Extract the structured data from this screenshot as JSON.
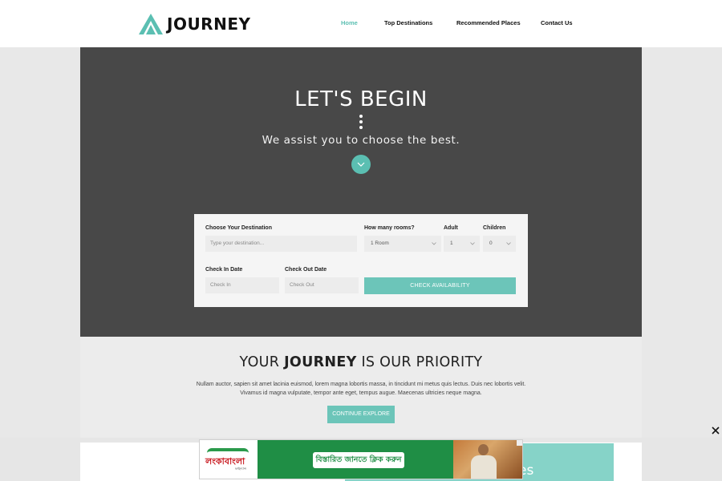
{
  "brand": {
    "name": "JOURNEY",
    "accent": "#5bbfb2"
  },
  "nav": {
    "items": [
      "Home",
      "Top Destinations",
      "Recommended Places",
      "Contact Us"
    ],
    "active": "Home"
  },
  "hero": {
    "title": "LET'S BEGIN",
    "subtitle": "We assist you to choose the best.",
    "scroll_icon": "chevron-down-icon"
  },
  "booking": {
    "destination_label": "Choose Your Destination",
    "destination_placeholder": "Type your destination...",
    "rooms_label": "How many rooms?",
    "rooms_value": "1 Room",
    "adult_label": "Adult",
    "adult_value": "1",
    "children_label": "Children",
    "children_value": "0",
    "checkin_label": "Check In Date",
    "checkin_placeholder": "Check In",
    "checkout_label": "Check Out Date",
    "checkout_placeholder": "Check Out",
    "submit_label": "CHECK AVAILABILITY"
  },
  "priority": {
    "title_pre": "YOUR",
    "title_bold": "JOURNEY",
    "title_post": "IS OUR PRIORITY",
    "text": "Nullam auctor, sapien sit amet lacinia euismod, lorem magna lobortis massa, in tincidunt mi metus quis lectus. Duis nec lobortis velit. Vivamus id magna vulputate, tempor ante eget, tempus augue. Maecenas ultricies neque magna.",
    "button_label": "CONTINUE EXPLORE"
  },
  "below": {
    "partial_text": "es"
  },
  "ad": {
    "logo_text": "লংকাবাংলা",
    "logo_subtext": "ফাইন্যান্স",
    "cta": "বিস্তারিত জানতে ক্লিক করুন",
    "close_icon": "close-icon"
  }
}
